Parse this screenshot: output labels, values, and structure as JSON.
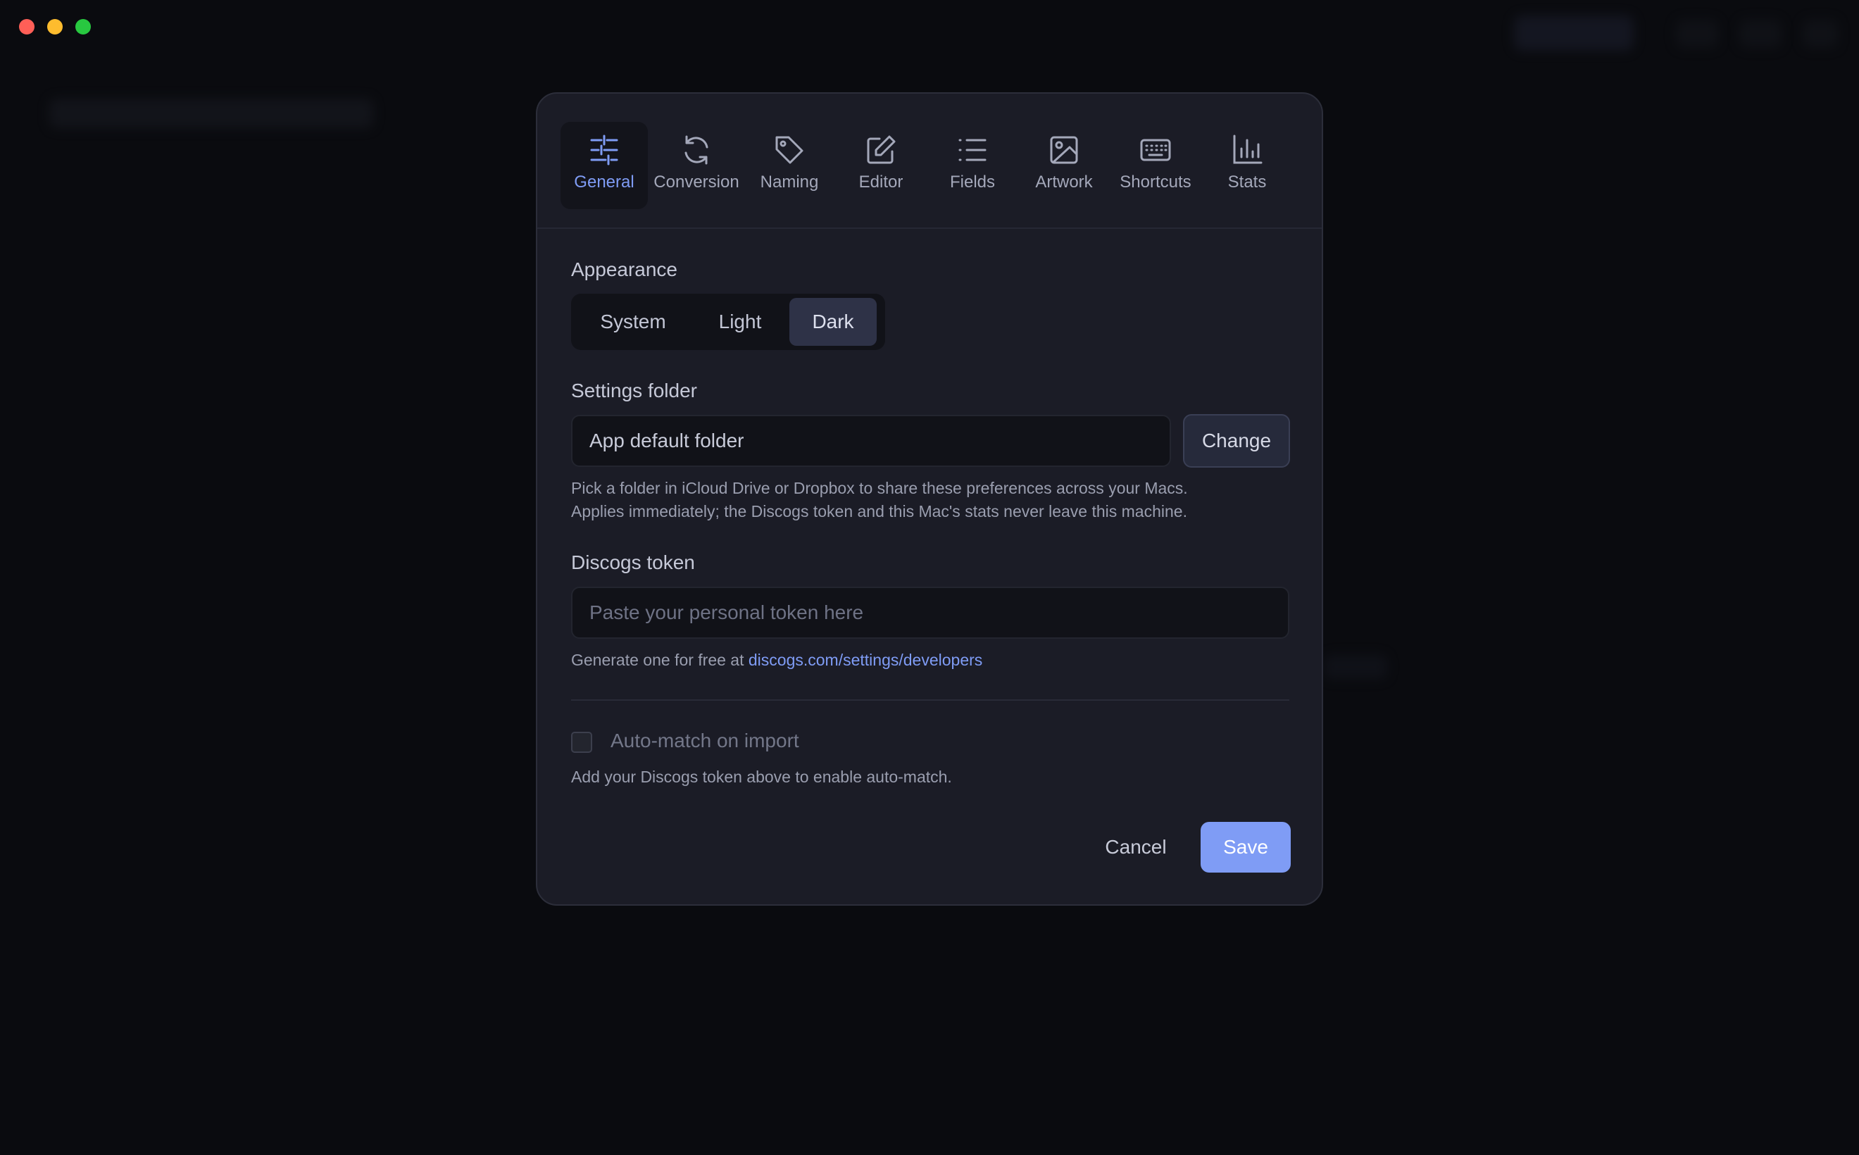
{
  "tabs": [
    {
      "label": "General",
      "icon": "sliders-icon",
      "active": true
    },
    {
      "label": "Conversion",
      "icon": "refresh-icon"
    },
    {
      "label": "Naming",
      "icon": "tag-icon"
    },
    {
      "label": "Editor",
      "icon": "edit-icon"
    },
    {
      "label": "Fields",
      "icon": "list-icon"
    },
    {
      "label": "Artwork",
      "icon": "image-icon"
    },
    {
      "label": "Shortcuts",
      "icon": "keyboard-icon"
    },
    {
      "label": "Stats",
      "icon": "bar-chart-icon"
    }
  ],
  "appearance": {
    "label": "Appearance",
    "options": [
      "System",
      "Light",
      "Dark"
    ],
    "selected": "Dark"
  },
  "settings_folder": {
    "label": "Settings folder",
    "value": "App default folder",
    "change_label": "Change",
    "help_line1": "Pick a folder in iCloud Drive or Dropbox to share these preferences across your Macs.",
    "help_line2": "Applies immediately; the Discogs token and this Mac's stats never leave this machine."
  },
  "discogs": {
    "label": "Discogs token",
    "placeholder": "Paste your personal token here",
    "help_prefix": "Generate one for free at ",
    "help_link": "discogs.com/settings/developers"
  },
  "auto_match": {
    "label": "Auto-match on import",
    "checked": false,
    "help": "Add your Discogs token above to enable auto-match."
  },
  "footer": {
    "cancel_label": "Cancel",
    "save_label": "Save"
  },
  "colors": {
    "accent": "#7f9cf5",
    "dialog_bg": "#1b1c26",
    "window_bg": "#0a0b0f"
  }
}
